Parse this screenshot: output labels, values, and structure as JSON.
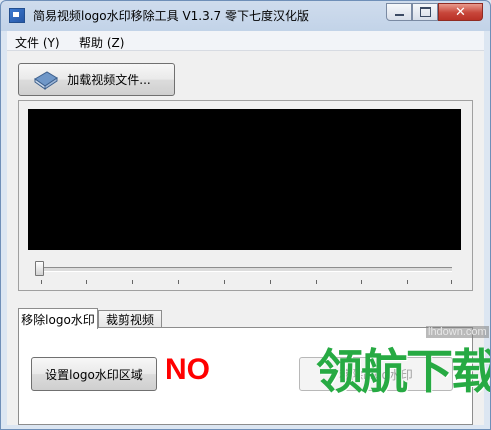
{
  "window": {
    "title": "简易视频logo水印移除工具 V1.3.7 零下七度汉化版",
    "controls": {
      "minimize": "",
      "maximize": "",
      "close": "✕"
    }
  },
  "menu": {
    "file": "文件 (Y)",
    "help": "帮助 (Z)"
  },
  "toolbar": {
    "load_label": "加载视频文件...",
    "load_icon": "book-icon"
  },
  "player": {
    "screen_color": "#000000",
    "position_fraction": 0.0
  },
  "tabs": [
    {
      "label": "移除logo水印",
      "active": true
    },
    {
      "label": "裁剪视频",
      "active": false
    }
  ],
  "remove_panel": {
    "set_region_label": "设置logo水印区域",
    "status": "NO",
    "status_color": "#ff0000",
    "remove_label": "移除logo水印",
    "remove_enabled": false
  },
  "watermark": {
    "logo_text": "领航下载",
    "url_text": "lhdown.com",
    "color": "#27aa43"
  }
}
